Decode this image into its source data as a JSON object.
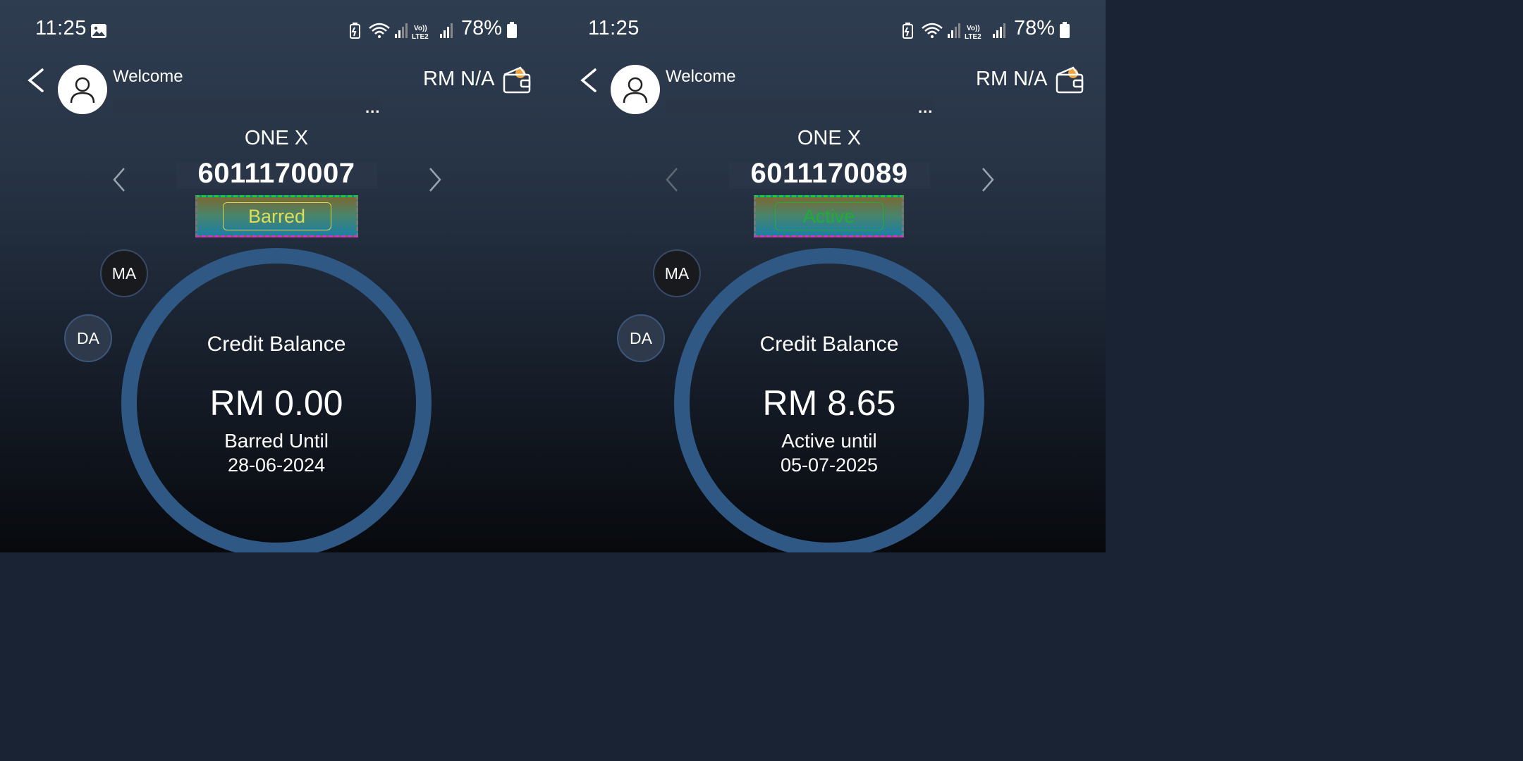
{
  "panels": [
    {
      "status_bar": {
        "time": "11:25",
        "battery": "78%",
        "network": "Vo)) LTE2"
      },
      "header": {
        "welcome": "Welcome",
        "more": "...",
        "balance": "RM N/A"
      },
      "plan": "ONE X",
      "number": "6011170007",
      "status": "Barred",
      "buttons": {
        "ma": "MA",
        "da": "DA"
      },
      "credit": {
        "label": "Credit Balance",
        "amount": "RM 0.00",
        "until_label": "Barred Until",
        "until_date": "28-06-2024"
      }
    },
    {
      "status_bar": {
        "time": "11:25",
        "battery": "78%",
        "network": "Vo)) LTE2"
      },
      "header": {
        "welcome": "Welcome",
        "more": "...",
        "balance": "RM N/A"
      },
      "plan": "ONE X",
      "number": "6011170089",
      "status": "Active",
      "buttons": {
        "ma": "MA",
        "da": "DA"
      },
      "credit": {
        "label": "Credit Balance",
        "amount": "RM 8.65",
        "until_label": "Active until",
        "until_date": "05-07-2025"
      }
    }
  ],
  "colors": {
    "barred": "#e1dc56",
    "active": "#1fae35",
    "ring": "#2f5884"
  }
}
